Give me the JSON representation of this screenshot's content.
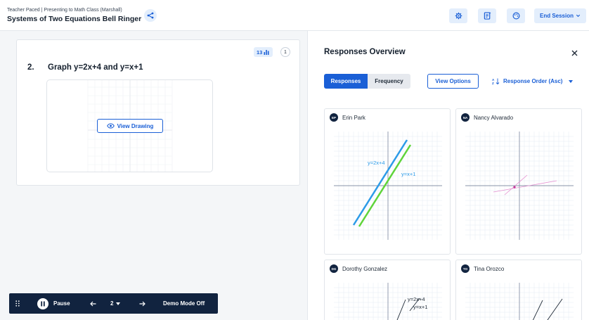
{
  "header": {
    "subtitle": "Teacher Paced | Presenting to Math Class (Marshall)",
    "title": "Systems of Two Equations Bell Ringer",
    "end_session": "End Session"
  },
  "question": {
    "number": "2.",
    "text": "Graph y=2x+4 and y=x+1",
    "response_count": "13",
    "badge": "1",
    "view_drawing": "View Drawing"
  },
  "toolbar": {
    "pause": "Pause",
    "current_item": "2",
    "demo_mode": "Demo Mode Off"
  },
  "panel": {
    "title": "Responses Overview",
    "tabs": [
      "Responses",
      "Frequency"
    ],
    "view_options": "View Options",
    "sort": "Response Order (Asc)"
  },
  "responses": [
    {
      "initials": "EP",
      "name": "Erin Park",
      "labels": [
        "y=2x+4",
        "y=x+1"
      ]
    },
    {
      "initials": "NA",
      "name": "Nancy Alvarado"
    },
    {
      "initials": "DG",
      "name": "Dorothy Gonzalez",
      "labels": [
        "y=2x+4",
        "y=x+1"
      ]
    },
    {
      "initials": "TO",
      "name": "Tina Orozco"
    }
  ],
  "colors": {
    "accent": "#1a5fd6",
    "navy": "#11233f",
    "line_blue": "#2c9be8",
    "line_green": "#5fd43a"
  }
}
